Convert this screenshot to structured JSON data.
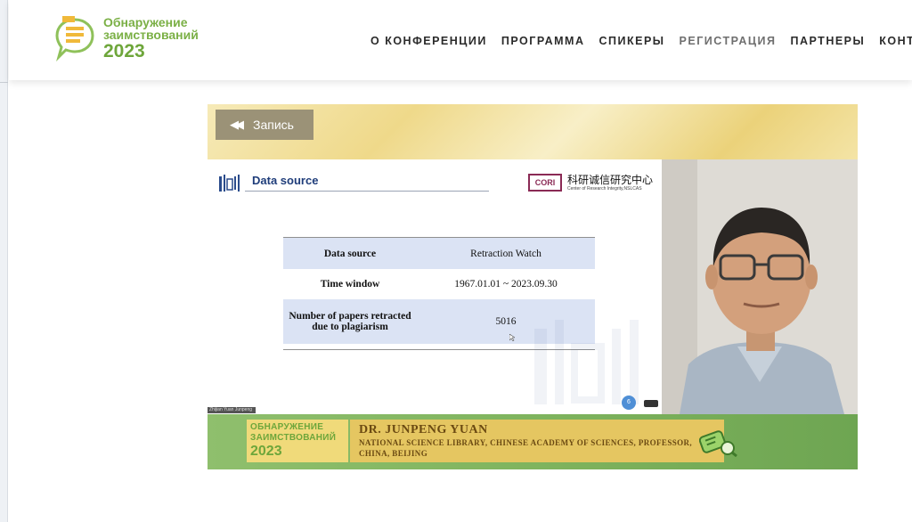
{
  "header": {
    "logo": {
      "line1": "Обнаружение",
      "line2": "заимствований",
      "year": "2023"
    },
    "nav": [
      {
        "label": "О КОНФЕРЕНЦИИ",
        "active": false
      },
      {
        "label": "ПРОГРАММА",
        "active": false
      },
      {
        "label": "СПИКЕРЫ",
        "active": false
      },
      {
        "label": "РЕГИСТРАЦИЯ",
        "active": true
      },
      {
        "label": "ПАРТНЕРЫ",
        "active": false
      },
      {
        "label": "КОНТАКТЫ",
        "active": false
      }
    ]
  },
  "video": {
    "back_button": {
      "label": "Запись",
      "icon": "rewind-icon"
    },
    "slide": {
      "title": "Data source",
      "org_badge": "CORI",
      "org_name_cn": "科研诚信研究中心",
      "org_name_en": "Center of Research Integrity,NSLCAS",
      "table": [
        {
          "label": "Data source",
          "value": "Retraction Watch"
        },
        {
          "label": "Time window",
          "value": "1967.01.01 ~ 2023.09.30"
        },
        {
          "label": "Number of papers retracted due to plagiarism",
          "value": "5016"
        }
      ]
    },
    "speaker_tag": "Zhijian Yuan Junpeng",
    "lower_third": {
      "logo_line1": "ОБНАРУЖЕНИЕ",
      "logo_line2": "ЗАИМСТВОВАНИЙ",
      "logo_year": "2023",
      "name": "DR. JUNPENG YUAN",
      "affiliation_line1": "NATIONAL SCIENCE LIBRARY, CHINESE ACADEMY OF SCIENCES, PROFESSOR,",
      "affiliation_line2": "CHINA, BEIJING"
    }
  },
  "colors": {
    "brand_green": "#7bb046",
    "nav_text": "#2b2b2b",
    "slide_title": "#1f3d7a",
    "table_band": "#dbe3f4",
    "lower_third_gold": "#e5c661"
  }
}
